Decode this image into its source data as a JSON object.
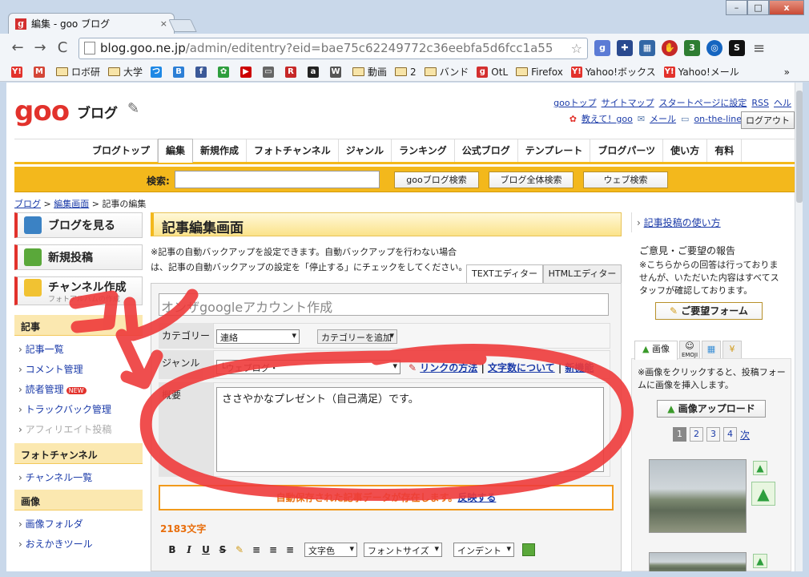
{
  "browser": {
    "tab_title": "編集 - goo ブログ",
    "tab_favicon": "g",
    "tab_close": "×",
    "window_buttons": {
      "minimize": "–",
      "maximize": "□",
      "close": "x"
    },
    "url_host": "blog.goo.ne.jp",
    "url_path": "/admin/editentry?eid=bae75c62249772c36eebfa5d6fcc1a55",
    "nav": {
      "back": "←",
      "forward": "→",
      "reload": "C"
    },
    "star": "☆",
    "menu": "≡",
    "bookmarks": [
      {
        "label": "",
        "icon": "Y!",
        "color": "#e2322c",
        "type": "site"
      },
      {
        "label": "",
        "icon": "M",
        "color": "#d44638",
        "type": "site"
      },
      {
        "label": "ロボ研",
        "type": "folder"
      },
      {
        "label": "大学",
        "type": "folder"
      },
      {
        "label": "",
        "icon": "つ",
        "color": "#1e88e5",
        "type": "site"
      },
      {
        "label": "",
        "icon": "B",
        "color": "#2c7fd6",
        "type": "site"
      },
      {
        "label": "",
        "icon": "f",
        "color": "#3b5998",
        "type": "site"
      },
      {
        "label": "",
        "icon": "✿",
        "color": "#2e9e3e",
        "type": "site"
      },
      {
        "label": "",
        "icon": "▶",
        "color": "#cc0000",
        "type": "site"
      },
      {
        "label": "",
        "icon": "▭",
        "color": "#666666",
        "type": "site"
      },
      {
        "label": "",
        "icon": "R",
        "color": "#c62828",
        "type": "site"
      },
      {
        "label": "",
        "icon": "a",
        "color": "#222222",
        "type": "site"
      },
      {
        "label": "",
        "icon": "W",
        "color": "#555555",
        "type": "site"
      },
      {
        "label": "動画",
        "type": "folder"
      },
      {
        "label": "2",
        "type": "folder"
      },
      {
        "label": "バンド",
        "type": "folder"
      },
      {
        "label": "OtL",
        "icon": "g",
        "color": "#d32f2f",
        "type": "site"
      },
      {
        "label": "Firefox",
        "type": "folder"
      },
      {
        "label": "Yahoo!ボックス",
        "icon": "Y!",
        "color": "#e2322c",
        "type": "site"
      },
      {
        "label": "Yahoo!メール",
        "icon": "Y!",
        "color": "#e2322c",
        "type": "site"
      }
    ],
    "bookmarks_overflow": "»"
  },
  "header": {
    "logo": "goo",
    "service": "ブログ",
    "top_links": [
      "gooトップ",
      "サイトマップ",
      "スタートページに設定",
      "RSS",
      "ヘル"
    ],
    "sub_links": [
      "教えて！goo",
      "メール",
      "on-the-line"
    ],
    "logout": "ログアウト"
  },
  "gnav": [
    "ブログトップ",
    "編集",
    "新規作成",
    "フォトチャンネル",
    "ジャンル",
    "ランキング",
    "公式ブログ",
    "テンプレート",
    "ブログパーツ",
    "使い方",
    "有料"
  ],
  "gnav_active": "編集",
  "search": {
    "label": "検索:",
    "buttons": [
      "gooブログ検索",
      "ブログ全体検索",
      "ウェブ検索"
    ]
  },
  "breadcrumb": {
    "home": "ブログ",
    "mid": "編集画面",
    "current": "記事の編集",
    "sep": ">"
  },
  "left": {
    "buttons": [
      "ブログを見る",
      "新規投稿",
      "チャンネル作成"
    ],
    "channel_sub": "フォトアルバムの作成",
    "sections": {
      "article": "記事",
      "article_links": [
        "記事一覧",
        "コメント管理",
        "読者管理",
        "トラックバック管理",
        "アフィリエイト投稿"
      ],
      "new_badge": "NEW",
      "photo": "フォトチャンネル",
      "photo_links": [
        "チャンネル一覧"
      ],
      "image": "画像",
      "image_links": [
        "画像フォルダ",
        "おえかきツール"
      ]
    }
  },
  "center": {
    "title": "記事編集画面",
    "notice": "※記事の自動バックアップを設定できます。自動バックアップを行わない場合は、記事の自動バックアップの設定を「停止する」にチェックをしてください。",
    "tabs": [
      "TEXTエディター",
      "HTMLエディター"
    ],
    "entry_title": "オンザgoogleアカウント作成",
    "category_label": "カテゴリー",
    "category_value": "連絡",
    "add_category": "カテゴリーを追加",
    "genre_label": "ジャンル",
    "genre_value": "└ウェブログ・",
    "genre_links": [
      "リンクの方法",
      "文字数について",
      "新機能"
    ],
    "summary_label": "概要",
    "summary_text": "ささやかなプレゼント（自己満足）です。",
    "autosave_text": "自動保存された記事データが存在します。",
    "autosave_link": "反映する",
    "char_count": "2183文字",
    "format_buttons": [
      "B",
      "I",
      "U",
      "S"
    ],
    "format_selects": [
      "文字色",
      "フォントサイズ",
      "インデント"
    ]
  },
  "right": {
    "help_link": "記事投稿の使い方",
    "feedback_title": "ご意見・ご要望の報告",
    "feedback_note": "※こちらからの回答は行っておりませんが、いただいた内容はすべてスタッフが確認しております。",
    "feedback_button": "ご要望フォーム",
    "image_tab": "画像",
    "emoji_tab": "EMOJI",
    "image_note": "※画像をクリックすると、投稿フォームに画像を挿入します。",
    "upload_button": "画像アップロード",
    "pages": [
      "1",
      "2",
      "3",
      "4"
    ],
    "next": "次"
  },
  "annotation": {
    "text": "コレ",
    "color": "#ee3b3b"
  }
}
